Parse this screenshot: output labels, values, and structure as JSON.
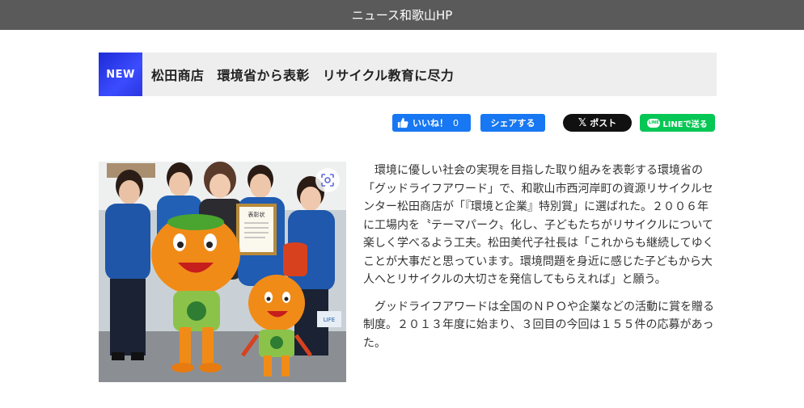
{
  "site": {
    "title": "ニュース和歌山HP"
  },
  "headline": {
    "badge": "NEW",
    "text": "松田商店　環境省から表彰　リサイクル教育に尽力"
  },
  "share": {
    "like_label": "いいね！",
    "like_count": "0",
    "share_label": "シェアする",
    "x_label": "ポスト",
    "line_label": "LINEで送る"
  },
  "photo": {
    "certificate_heading": "表彰状",
    "bag_text": "LIFE"
  },
  "article": {
    "paragraphs": [
      "環境に優しい社会の実現を目指した取り組みを表彰する環境省の「グッドライフアワード」で、和歌山市西河岸町の資源リサイクルセンター松田商店が「『環境と企業』特別賞」に選ばれた。２００６年に工場内を〝テーマパーク〟化し、子どもたちがリサイクルについて楽しく学べるよう工夫。松田美代子社長は「これからも継続してゆくことが大事だと思っています。環境問題を身近に感じた子どもから大人へとリサイクルの大切さを発信してもらえれば」と願う。",
      "グッドライフアワードは全国のＮＰＯや企業などの活動に賞を贈る制度。２０１３年度に始まり、３回目の今回は１５５件の応募があった。"
    ]
  }
}
